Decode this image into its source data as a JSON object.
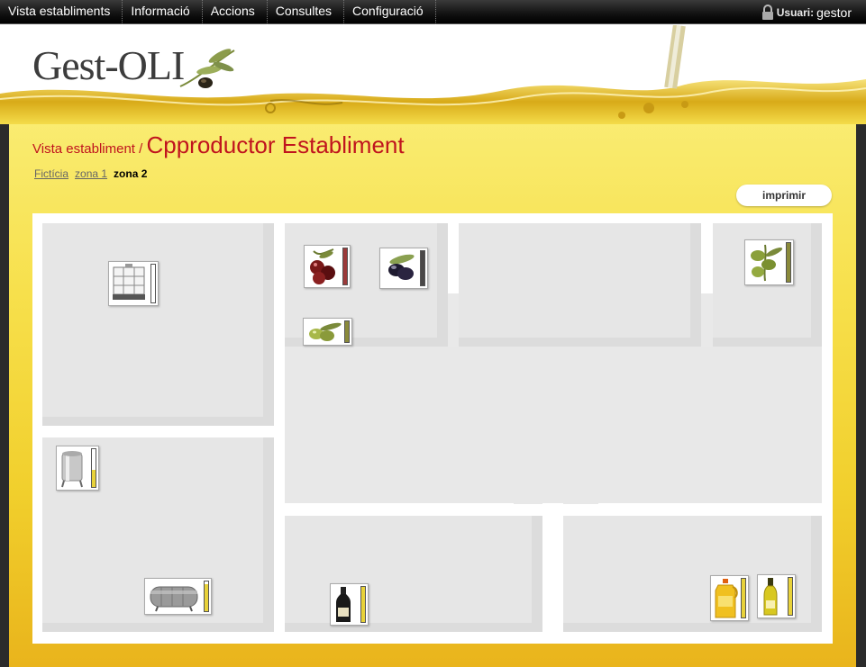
{
  "nav": {
    "menu": [
      "Vista establiments",
      "Informació",
      "Accions",
      "Consultes",
      "Configuració"
    ],
    "user_label": "Usuari:",
    "user_name": "gestor"
  },
  "header": {
    "logo_text": "Gest-OLI"
  },
  "page": {
    "breadcrumb": "Vista establiment",
    "separator": " / ",
    "title": "Cpproductor Establiment"
  },
  "zones": [
    {
      "label": "Fictícia",
      "active": false
    },
    {
      "label": "zona 1",
      "active": false
    },
    {
      "label": "zona 2",
      "active": true
    }
  ],
  "print_label": "imprimir",
  "colors": {
    "accent_red": "#c0141e",
    "panel_yellow": "#f7e04c",
    "gauge_red_olive": "#9b3a3a",
    "gauge_black_olive": "#4a4848",
    "gauge_green": "#8a8a3a",
    "gauge_yellow": "#e8d23a"
  },
  "plan_items": [
    {
      "name": "ibc-container-icon",
      "level": 0.0,
      "gauge_color": "#e8d23a"
    },
    {
      "name": "red-olives-icon",
      "level": 1.0,
      "gauge_color": "#9b3a3a"
    },
    {
      "name": "black-olives-icon",
      "level": 1.0,
      "gauge_color": "#4a4848"
    },
    {
      "name": "green-olives-small-icon",
      "level": 1.0,
      "gauge_color": "#8a8a3a"
    },
    {
      "name": "green-olives-icon",
      "level": 1.0,
      "gauge_color": "#8a8a3a"
    },
    {
      "name": "steel-tank-icon",
      "level": 0.45,
      "gauge_color": "#e8d23a"
    },
    {
      "name": "horizontal-tank-icon",
      "level": 0.9,
      "gauge_color": "#e8d23a"
    },
    {
      "name": "oil-bottle-dark-icon",
      "level": 1.0,
      "gauge_color": "#e8d23a"
    },
    {
      "name": "oil-jug-icon",
      "level": 1.0,
      "gauge_color": "#e8d23a"
    },
    {
      "name": "oil-bottle-glass-icon",
      "level": 1.0,
      "gauge_color": "#e8d23a"
    }
  ]
}
